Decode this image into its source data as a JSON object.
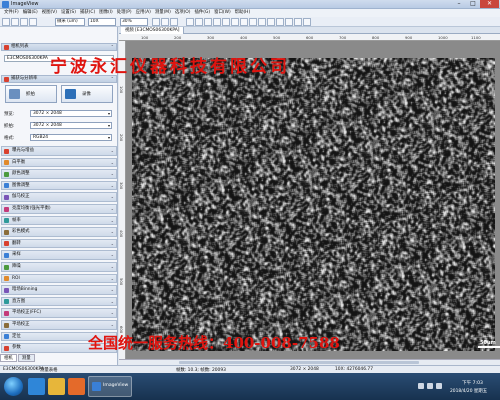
{
  "window": {
    "title": "ImageView"
  },
  "menu": [
    "文件(F)",
    "编辑(E)",
    "视图(V)",
    "设置(S)",
    "捕获(C)",
    "图像(I)",
    "处理(P)",
    "应用(A)",
    "测量(M)",
    "选项(O)",
    "插件(G)",
    "窗口(W)",
    "帮助(H)"
  ],
  "toolbar": {
    "unit": "微米 (um)",
    "magnification": "10X",
    "zoom": "30%"
  },
  "left_panel": {
    "camera_list_header": "相机列表",
    "camera_name": "E3CMOS06300KPA",
    "capture_header": "捕获与分辨率",
    "capture_button": "抓拍",
    "record_button": "录像",
    "preview_label": "预览:",
    "preview_value": "3072 × 2048",
    "snap_label": "抓拍:",
    "snap_value": "3072 × 2048",
    "format_label": "格式:",
    "format_value": "RGB24",
    "items": [
      "曝光与增益",
      "白平衡",
      "颜色调整",
      "图像调整",
      "伽马校正",
      "亮度均衡(强光平衡)",
      "帧率",
      "彩色模式",
      "翻转",
      "采样",
      "降噪",
      "ROI",
      "暗场Binning",
      "直方图",
      "平场校正(FFC)",
      "平场校正",
      "定位",
      "参数"
    ],
    "tabs": [
      "相机",
      "测量"
    ],
    "measure_table": "测量表格"
  },
  "document": {
    "tab_label": "视频 [E3CMOS06300KPA]",
    "scale_label": "50um",
    "ruler_top": [
      "100",
      "200",
      "300",
      "400",
      "500",
      "600",
      "700",
      "800",
      "900",
      "1000",
      "1100"
    ],
    "ruler_left": [
      "100",
      "200",
      "300",
      "400",
      "500",
      "600"
    ]
  },
  "watermark": {
    "company": "宁波永汇仪器科技有限公司",
    "hotline": "全国统一服务热线：400-008-7588"
  },
  "status": {
    "camera": "E3CMOS06300KPA",
    "frame": "帧数: 10.3; 帧数: 20093",
    "resolution": "3072 × 2048",
    "info": "10X: 4276046.77"
  },
  "taskbar": {
    "app_label": "ImageView",
    "time": "下午 7:03",
    "date": "2018/4/20 星期五"
  },
  "colors": {
    "watermark": "#e0140f",
    "taskbar": "#1f3f63",
    "panel_header": "#c9d6e8"
  }
}
